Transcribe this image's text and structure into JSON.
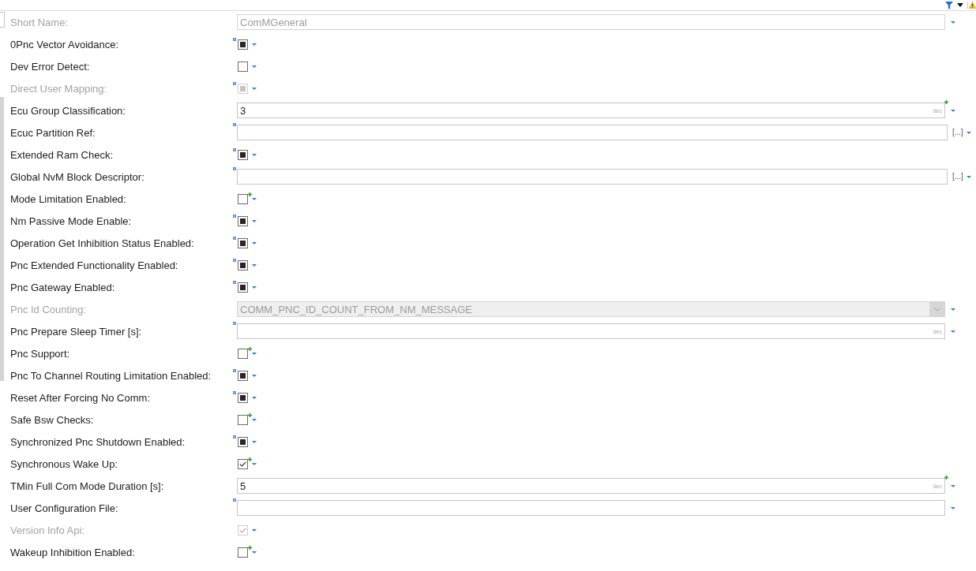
{
  "fields": [
    {
      "label": "Short Name:",
      "kind": "text",
      "disabled": true,
      "value": "ComMGeneral",
      "derived": false,
      "user_defined": false
    },
    {
      "label": "0Pnc Vector Avoidance:",
      "kind": "checkbox",
      "disabled": false,
      "checked": true,
      "derived": true,
      "user_defined": false
    },
    {
      "label": "Dev Error Detect:",
      "kind": "checkbox",
      "disabled": false,
      "checked": false,
      "derived": false,
      "user_defined": false
    },
    {
      "label": "Direct User Mapping:",
      "kind": "checkbox",
      "disabled": true,
      "checked": true,
      "derived": true,
      "user_defined": false
    },
    {
      "label": "Ecu Group Classification:",
      "kind": "number",
      "disabled": false,
      "value": "3",
      "format": "dec",
      "derived": false,
      "user_defined": true
    },
    {
      "label": "Ecuc Partition Ref:",
      "kind": "reference",
      "disabled": false,
      "button": "[...]",
      "derived": true,
      "user_defined": false
    },
    {
      "label": "Extended Ram Check:",
      "kind": "checkbox",
      "disabled": false,
      "checked": true,
      "derived": true,
      "user_defined": false
    },
    {
      "label": "Global NvM Block Descriptor:",
      "kind": "reference",
      "disabled": false,
      "button": "[...]",
      "derived": true,
      "user_defined": false
    },
    {
      "label": "Mode Limitation Enabled:",
      "kind": "checkbox",
      "disabled": false,
      "checked": false,
      "derived": false,
      "user_defined": true
    },
    {
      "label": "Nm Passive Mode Enable:",
      "kind": "checkbox",
      "disabled": false,
      "checked": true,
      "derived": true,
      "user_defined": false
    },
    {
      "label": "Operation Get Inhibition Status Enabled:",
      "kind": "checkbox",
      "disabled": false,
      "checked": true,
      "derived": true,
      "user_defined": false
    },
    {
      "label": "Pnc Extended Functionality Enabled:",
      "kind": "checkbox",
      "disabled": false,
      "checked": true,
      "derived": true,
      "user_defined": false
    },
    {
      "label": "Pnc Gateway Enabled:",
      "kind": "checkbox",
      "disabled": false,
      "checked": true,
      "derived": true,
      "user_defined": false
    },
    {
      "label": "Pnc Id Counting:",
      "kind": "combo",
      "disabled": true,
      "value": "COMM_PNC_ID_COUNT_FROM_NM_MESSAGE",
      "derived": false,
      "user_defined": false
    },
    {
      "label": "Pnc Prepare Sleep Timer [s]:",
      "kind": "number",
      "disabled": false,
      "format": "dec",
      "derived": true,
      "user_defined": false
    },
    {
      "label": "Pnc Support:",
      "kind": "checkbox",
      "disabled": false,
      "checked": false,
      "derived": false,
      "user_defined": true
    },
    {
      "label": "Pnc To Channel Routing Limitation Enabled:",
      "kind": "checkbox",
      "disabled": false,
      "checked": true,
      "derived": true,
      "user_defined": false
    },
    {
      "label": "Reset After Forcing No Comm:",
      "kind": "checkbox",
      "disabled": false,
      "checked": true,
      "derived": true,
      "user_defined": false
    },
    {
      "label": "Safe Bsw Checks:",
      "kind": "checkbox",
      "disabled": false,
      "checked": false,
      "derived": false,
      "user_defined": true
    },
    {
      "label": "Synchronized Pnc Shutdown Enabled:",
      "kind": "checkbox",
      "disabled": false,
      "checked": true,
      "derived": true,
      "user_defined": false
    },
    {
      "label": "Synchronous Wake Up:",
      "kind": "checkbox",
      "disabled": false,
      "checked": true,
      "derived": false,
      "user_defined": true
    },
    {
      "label": "TMin Full Com Mode Duration [s]:",
      "kind": "number",
      "disabled": false,
      "value": "5",
      "format": "dec",
      "derived": false,
      "user_defined": true
    },
    {
      "label": "User Configuration File:",
      "kind": "text",
      "disabled": false,
      "derived": true,
      "user_defined": false
    },
    {
      "label": "Version Info Api:",
      "kind": "checkbox",
      "disabled": true,
      "checked": true,
      "derived": false,
      "user_defined": false
    },
    {
      "label": "Wakeup Inhibition Enabled:",
      "kind": "checkbox",
      "disabled": false,
      "checked": false,
      "derived": false,
      "user_defined": true
    }
  ]
}
